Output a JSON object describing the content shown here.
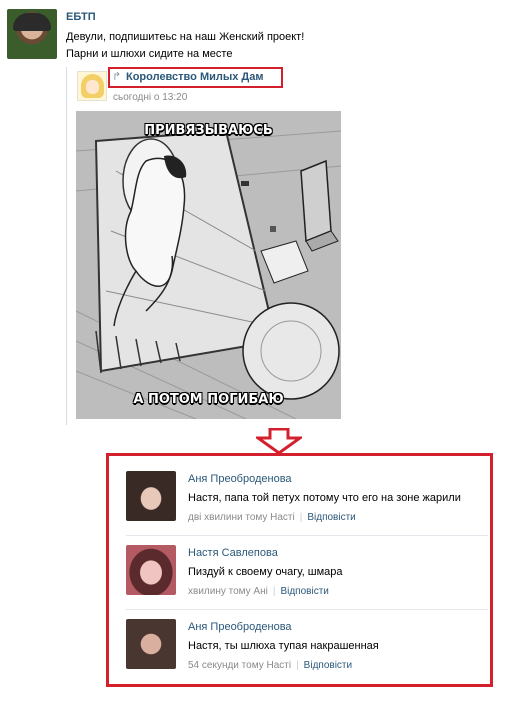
{
  "post": {
    "author": "ЕБТП",
    "text_line1": "Девули, подпишитеьс на наш Женский проект!",
    "text_line2": "Парни и шлюхи сидите на месте"
  },
  "repost": {
    "arrow": "↱",
    "source": "Королевство Милых Дам",
    "time": "сьогодні о 13:20"
  },
  "meme": {
    "top_caption": "ПРИВЯЗЫВАЮСЬ",
    "bottom_caption": "А ПОТОМ ПОГИБАЮ"
  },
  "comments": [
    {
      "name": "Аня Преоброденова",
      "text": "Настя, папа той петух потому что его на зоне жарили",
      "time": "дві хвилини тому Насті",
      "reply": "Відповісти"
    },
    {
      "name": "Настя Савлепова",
      "text": "Пиздуй к своему очагу, шмара",
      "time": "хвилину тому Ані",
      "reply": "Відповісти"
    },
    {
      "name": "Аня Преоброденова",
      "text": "Настя, ты шлюха тупая накрашенная",
      "time": "54 секунди тому Насті",
      "reply": "Відповісти"
    }
  ],
  "colors": {
    "link": "#2b587a",
    "highlight": "#d4202c",
    "meta": "#8a8a8a"
  }
}
